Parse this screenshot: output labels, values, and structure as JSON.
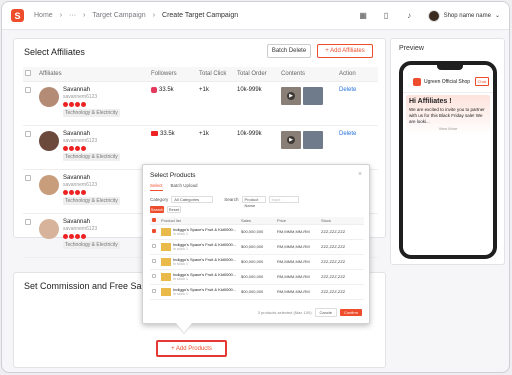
{
  "header": {
    "breadcrumb": [
      "Home",
      "···",
      "Target Campaign",
      "Create Target Campaign"
    ],
    "user_name": "Shop name name",
    "icons": [
      "grid-icon",
      "book-icon",
      "bell-icon"
    ]
  },
  "affiliates": {
    "title": "Select Affiliates",
    "batch_delete": "Batch Delete",
    "add_affiliates": "+ Add Affiliates",
    "columns": [
      "Affiliates",
      "Followers",
      "Total Click",
      "Total Order",
      "Contents",
      "Action"
    ],
    "rows": [
      {
        "name": "Savannah",
        "id": "savannem6123",
        "tag": "Technology & Electricity",
        "followers": "33.5k",
        "followers_platform": "instagram",
        "clicks": "+1k",
        "orders": "10k-999k",
        "action": "Delete"
      },
      {
        "name": "Savannah",
        "id": "savannem6123",
        "tag": "Technology & Electricity",
        "followers": "33.5k",
        "followers_platform": "youtube",
        "clicks": "+1k",
        "orders": "10k-999k",
        "action": "Delete"
      },
      {
        "name": "Savannah",
        "id": "savannem6123",
        "tag": "Technology & Electricity",
        "followers": "",
        "followers_platform": "",
        "clicks": "",
        "orders": "",
        "action": ""
      },
      {
        "name": "Savannah",
        "id": "savannem6123",
        "tag": "Technology & Electricity",
        "followers": "",
        "followers_platform": "",
        "clicks": "",
        "orders": "",
        "action": ""
      }
    ]
  },
  "commission": {
    "title": "Set Commission and Free Samp",
    "add_products": "+ Add Products"
  },
  "preview": {
    "title": "Preview",
    "shop_name": "Ugreen Official Shop",
    "chat": "Chat",
    "greeting": "Hi Affiliates !",
    "message": "We are excited to invite you to partner with us for this Black Friday sale! We are looki...",
    "view_more": "View More"
  },
  "modal": {
    "title": "Select Products",
    "tabs": [
      "Select",
      "Batch Upload"
    ],
    "category_label": "Category",
    "category_value": "All Categories",
    "search_label": "Search",
    "search_field": "Product Name",
    "search_placeholder": "Input",
    "search_btn": "Search",
    "reset_btn": "Reset",
    "columns": [
      "Product list",
      "Sales",
      "Price",
      "Stock"
    ],
    "products": [
      {
        "name": "Indiggo's Space's Fruit & Kid0000...",
        "sub": "In stock 1",
        "sales": "$00,000,000",
        "price": "RM,MMM,MM-RM",
        "stock": "ZZZ,ZZZ,ZZZ",
        "checked": true
      },
      {
        "name": "Indiggo's Space's Fruit & Kid0000...",
        "sub": "In stock 1",
        "sales": "$00,000,000",
        "price": "RM,MMM,MM-RM",
        "stock": "ZZZ,ZZZ,ZZZ",
        "checked": false
      },
      {
        "name": "Indiggo's Space's Fruit & Kid0000...",
        "sub": "In stock 1",
        "sales": "$00,000,000",
        "price": "RM,MMM,MM-RM",
        "stock": "ZZZ,ZZZ,ZZZ",
        "checked": false
      },
      {
        "name": "Indiggo's Space's Fruit & Kid0000...",
        "sub": "In stock 1",
        "sales": "$00,000,000",
        "price": "RM,MMM,MM-RM",
        "stock": "ZZZ,ZZZ,ZZZ",
        "checked": false
      },
      {
        "name": "Indiggo's Space's Fruit & Kid0000...",
        "sub": "In stock 1",
        "sales": "$00,000,000",
        "price": "RM,MMM,MM-RM",
        "stock": "ZZZ,ZZZ,ZZZ",
        "checked": false
      }
    ],
    "footer_note": "3 products selected (Max 100)",
    "cancel": "Cancle",
    "confirm": "Confirm"
  }
}
